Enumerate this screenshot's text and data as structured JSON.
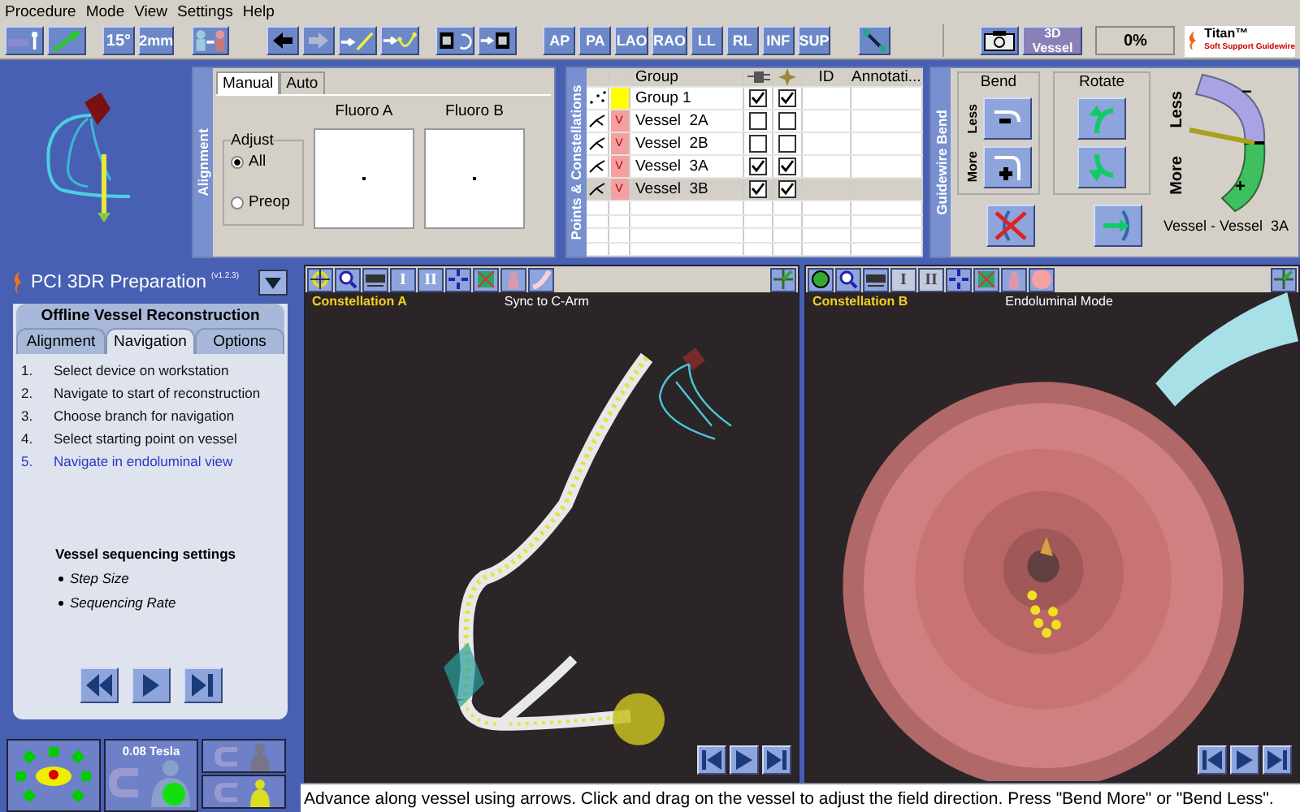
{
  "menu": [
    "Procedure",
    "Mode",
    "View",
    "Settings",
    "Help"
  ],
  "toolbar": {
    "angle": "15°",
    "step": "2mm",
    "views": [
      "AP",
      "PA",
      "LAO",
      "RAO",
      "LL",
      "RL",
      "INF",
      "SUP"
    ],
    "vessel_button": "3D Vessel",
    "progress": {
      "text": "0%"
    },
    "logo": {
      "name": "Titan™",
      "tagline": "Soft Support Guidewire"
    }
  },
  "alignment": {
    "label": "Alignment",
    "tabs": [
      {
        "label": "Manual",
        "selected": true
      },
      {
        "label": "Auto",
        "selected": false
      }
    ],
    "legend": "Adjust",
    "options": [
      {
        "label": "All",
        "selected": true
      },
      {
        "label": "Preop",
        "selected": false
      }
    ],
    "fluoro": [
      "Fluoro A",
      "Fluoro B"
    ]
  },
  "points": {
    "label": "Points & Constellations",
    "group_header": "Group",
    "id_header": "ID",
    "annotation_header": "Annotati...",
    "rows": [
      {
        "kind": "group",
        "name": "Group 1",
        "color": "#ffff00",
        "visible": true,
        "active": true,
        "selected": false
      },
      {
        "kind": "vessel",
        "badge": "V",
        "name": "Vessel  2A",
        "color": "#f4a0a0",
        "visible": false,
        "active": false,
        "selected": false
      },
      {
        "kind": "vessel",
        "badge": "V",
        "name": "Vessel  2B",
        "color": "#f4a0a0",
        "visible": false,
        "active": false,
        "selected": false
      },
      {
        "kind": "vessel",
        "badge": "V",
        "name": "Vessel  3A",
        "color": "#f4a0a0",
        "visible": true,
        "active": true,
        "selected": false
      },
      {
        "kind": "vessel",
        "badge": "V",
        "name": "Vessel  3B",
        "color": "#f4a0a0",
        "visible": true,
        "active": true,
        "selected": true
      }
    ]
  },
  "guidewire": {
    "label": "Guidewire Bend",
    "bend": "Bend",
    "rotate": "Rotate",
    "less": "Less",
    "more": "More",
    "gauge_less": "Less",
    "gauge_more": "More",
    "minus": "−",
    "plus": "+",
    "vessel": "Vessel - Vessel  3A"
  },
  "prep": {
    "title": "PCI 3DR Preparation",
    "version": "(v1.2.3)",
    "section": "Offline Vessel Reconstruction",
    "tabs": [
      {
        "label": "Alignment",
        "selected": false
      },
      {
        "label": "Navigation",
        "selected": true
      },
      {
        "label": "Options",
        "selected": false
      }
    ],
    "steps": [
      {
        "number": "1.",
        "text": "Select device on workstation",
        "selected": false
      },
      {
        "number": "2.",
        "text": "Navigate to start of reconstruction",
        "selected": false
      },
      {
        "number": "3.",
        "text": "Choose branch for navigation",
        "selected": false
      },
      {
        "number": "4.",
        "text": "Select starting point on vessel",
        "selected": false
      },
      {
        "number": "5.",
        "text": "Navigate in endoluminal view",
        "selected": true
      }
    ],
    "settings_title": "Vessel sequencing settings",
    "settings": [
      "Step Size",
      "Sequencing Rate"
    ]
  },
  "tesla": "0.08 Tesla",
  "viewports": [
    {
      "kind": "vessel",
      "title": "Constellation A",
      "mode": "Sync to C-Arm",
      "tools": [
        "I",
        "II"
      ]
    },
    {
      "kind": "endoluminal",
      "title": "Constellation B",
      "mode": "Endoluminal Mode",
      "tools": [
        "I",
        "II"
      ]
    }
  ],
  "status": "Advance along vessel using arrows. Click and drag on the vessel to adjust the field direction. Press \"Bend More\" or \"Bend Less\"."
}
